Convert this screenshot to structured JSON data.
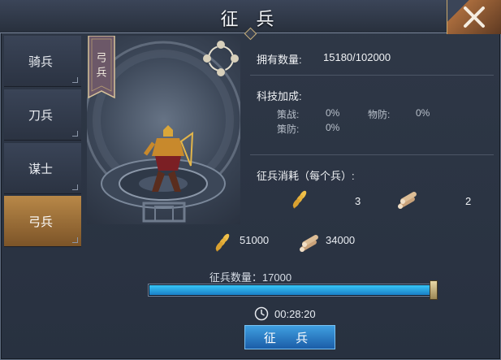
{
  "window": {
    "title": "征 兵"
  },
  "sidebar": {
    "items": [
      {
        "label": "骑兵",
        "active": false
      },
      {
        "label": "刀兵",
        "active": false
      },
      {
        "label": "谋士",
        "active": false
      },
      {
        "label": "弓兵",
        "active": true
      }
    ]
  },
  "preview": {
    "banner": "弓兵",
    "unit": "archer"
  },
  "info": {
    "owned_label": "拥有数量:",
    "owned_value": "15180/102000",
    "tech_label": "科技加成:",
    "tech": {
      "war_label": "策战:",
      "war_value": "0%",
      "phys_def_label": "物防:",
      "phys_def_value": "0%",
      "strat_def_label": "策防:",
      "strat_def_value": "0%"
    },
    "cost_label": "征兵消耗（每个兵）:",
    "cost": {
      "grain": "3",
      "wood": "2"
    }
  },
  "totals": {
    "grain": "51000",
    "wood": "34000"
  },
  "recruit": {
    "count_label": "征兵数量：17000",
    "slider_percent": 100,
    "timer": "00:28:20",
    "button_label": "征 兵"
  },
  "colors": {
    "accent_gold": "#b88848",
    "slider_blue": "#2aa3e3",
    "button_blue": "#2b7cc8"
  },
  "icons": [
    "close-icon",
    "cycle-icon",
    "grain-icon",
    "wood-icon",
    "clock-icon"
  ]
}
